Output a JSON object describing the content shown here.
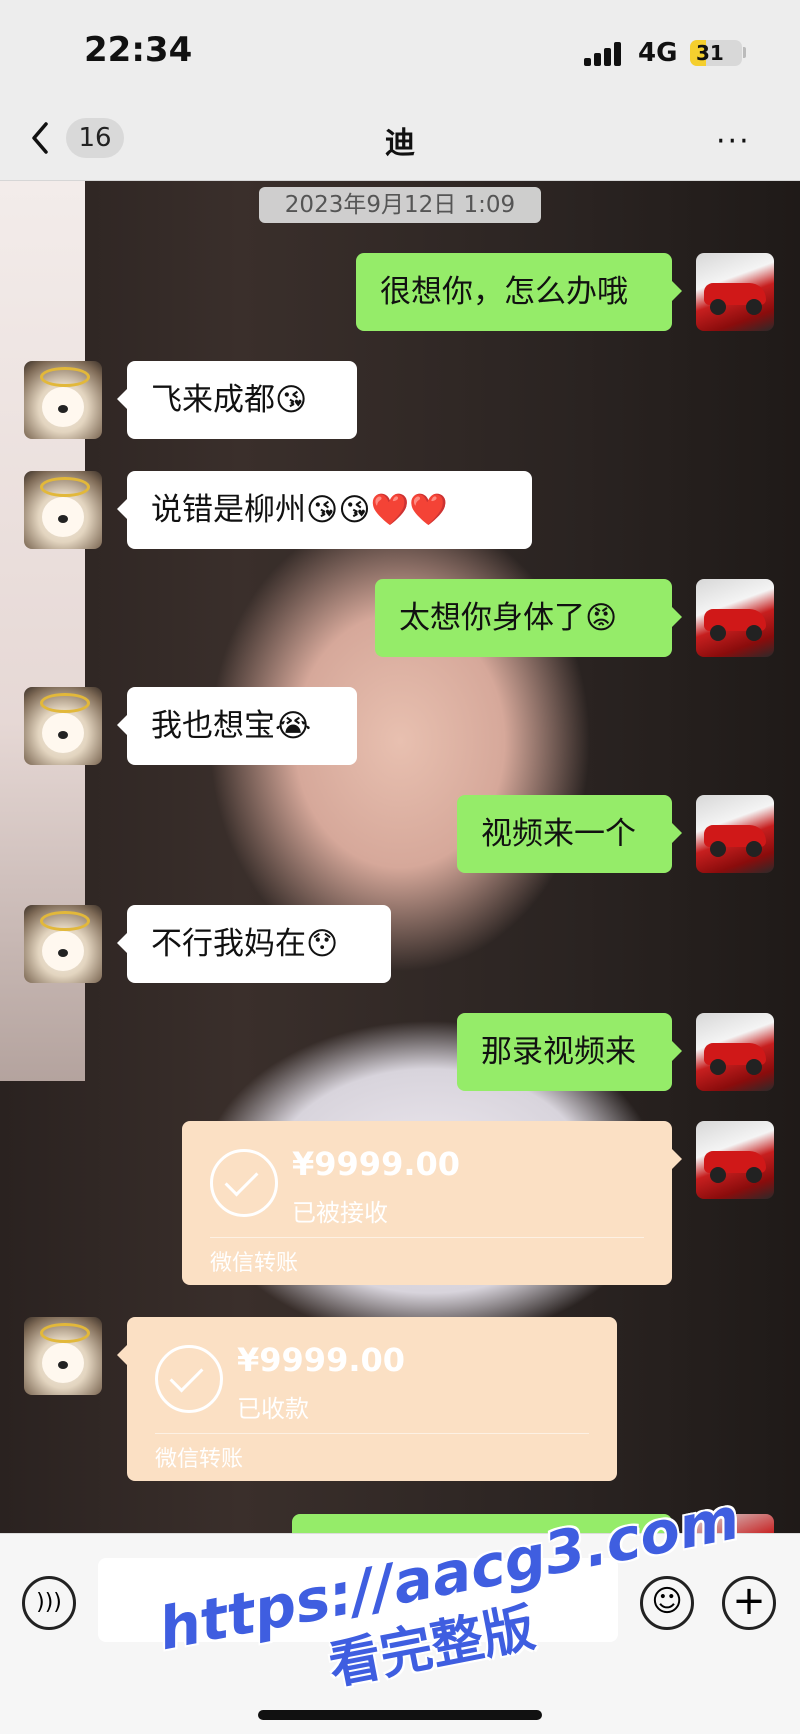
{
  "status_bar": {
    "time": "22:34",
    "network": "4G",
    "battery": "31",
    "battery_level": 0.31
  },
  "nav": {
    "unread_count": "16",
    "title": "迪",
    "more": "···"
  },
  "chat": {
    "timestamp": "2023年9月12日 1:09",
    "messages": [
      {
        "side": "out",
        "text": "很想你，怎么办哦"
      },
      {
        "side": "in",
        "text": "飞来成都😘"
      },
      {
        "side": "in",
        "text": "说错是柳州😘😘❤️❤️"
      },
      {
        "side": "out",
        "text": "太想你身体了😡"
      },
      {
        "side": "in",
        "text": "我也想宝😭"
      },
      {
        "side": "out",
        "text": "视频来一个"
      },
      {
        "side": "in",
        "text": "不行我妈在😯"
      },
      {
        "side": "out",
        "text": "那录视频来"
      }
    ],
    "transfers": [
      {
        "side": "out",
        "amount": "¥9999.00",
        "status": "已被接收",
        "label": "微信转账"
      },
      {
        "side": "in",
        "amount": "¥9999.00",
        "status": "已收款",
        "label": "微信转账"
      }
    ]
  },
  "input_bar": {
    "placeholder": ""
  },
  "watermark": {
    "url": "https://aacg3.com",
    "text": "看完整版"
  },
  "colors": {
    "outgoing_bubble": "#95ec69",
    "incoming_bubble": "#ffffff",
    "transfer_bubble": "#fbe0c4",
    "watermark": "#3f5ee0"
  },
  "icons": [
    "back-chevron-icon",
    "more-dots-icon",
    "voice-icon",
    "emoji-icon",
    "plus-icon",
    "transfer-check-icon"
  ]
}
